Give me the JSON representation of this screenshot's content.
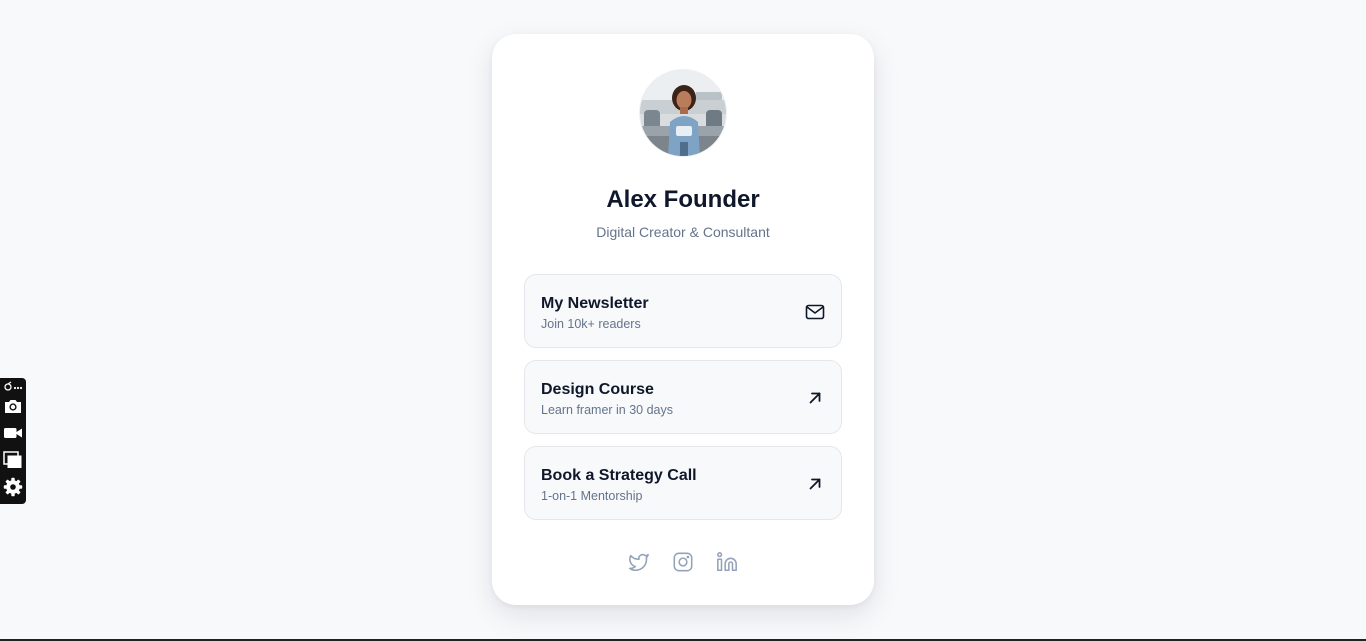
{
  "profile": {
    "name": "Alex Founder",
    "tagline": "Digital Creator & Consultant"
  },
  "links": [
    {
      "title": "My Newsletter",
      "subtitle": "Join 10k+ readers",
      "icon": "mail-icon"
    },
    {
      "title": "Design Course",
      "subtitle": "Learn framer in 30 days",
      "icon": "arrow-up-right-icon"
    },
    {
      "title": "Book a Strategy Call",
      "subtitle": "1-on-1 Mentorship",
      "icon": "arrow-up-right-icon"
    }
  ],
  "social": [
    "twitter-icon",
    "instagram-icon",
    "linkedin-icon"
  ],
  "toolbar": [
    "extension-menu-icon",
    "camera-icon",
    "video-camera-icon",
    "windows-icon",
    "gear-icon"
  ],
  "colors": {
    "background": "#f8f9fb",
    "card": "#ffffff",
    "text_primary": "#0f172a",
    "text_secondary": "#64748b",
    "link_bg": "#f8f9fb",
    "link_border": "#e5e7eb",
    "social_icon": "#94a3b8"
  }
}
